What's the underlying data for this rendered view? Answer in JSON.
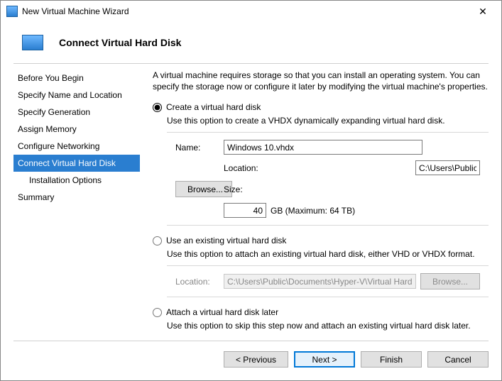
{
  "window": {
    "title": "New Virtual Machine Wizard"
  },
  "header": {
    "heading": "Connect Virtual Hard Disk"
  },
  "nav": {
    "items": [
      {
        "label": "Before You Begin"
      },
      {
        "label": "Specify Name and Location"
      },
      {
        "label": "Specify Generation"
      },
      {
        "label": "Assign Memory"
      },
      {
        "label": "Configure Networking"
      },
      {
        "label": "Connect Virtual Hard Disk"
      },
      {
        "label": "Installation Options"
      },
      {
        "label": "Summary"
      }
    ]
  },
  "content": {
    "intro": "A virtual machine requires storage so that you can install an operating system. You can specify the storage now or configure it later by modifying the virtual machine's properties.",
    "opt_create": {
      "label": "Create a virtual hard disk",
      "desc": "Use this option to create a VHDX dynamically expanding virtual hard disk.",
      "name_label": "Name:",
      "name_value": "Windows 10.vhdx",
      "loc_label": "Location:",
      "loc_value": "C:\\Users\\Public\\Documents\\Hyper-V\\Virtual Hard Disks\\",
      "browse": "Browse...",
      "size_label": "Size:",
      "size_value": "40",
      "size_unit": "GB (Maximum: 64 TB)"
    },
    "opt_existing": {
      "label": "Use an existing virtual hard disk",
      "desc": "Use this option to attach an existing virtual hard disk, either VHD or VHDX format.",
      "loc_label": "Location:",
      "loc_value": "C:\\Users\\Public\\Documents\\Hyper-V\\Virtual Hard Disks\\",
      "browse": "Browse..."
    },
    "opt_later": {
      "label": "Attach a virtual hard disk later",
      "desc": "Use this option to skip this step now and attach an existing virtual hard disk later."
    }
  },
  "footer": {
    "previous": "< Previous",
    "next": "Next >",
    "finish": "Finish",
    "cancel": "Cancel"
  }
}
